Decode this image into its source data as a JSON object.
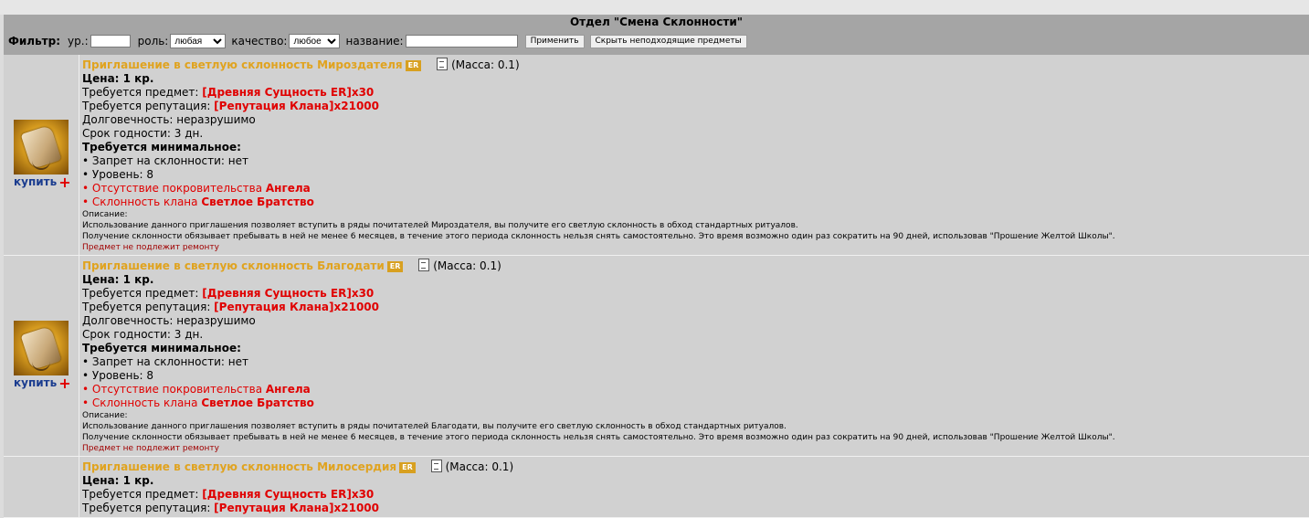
{
  "header": {
    "title": "Отдел \"Смена Склонности\""
  },
  "filter": {
    "label": "Фильтр:",
    "level_label": "ур.:",
    "level_value": "",
    "role_label": "роль:",
    "role_selected": "любая",
    "quality_label": "качество:",
    "quality_selected": "любое",
    "name_label": "название:",
    "name_value": "",
    "apply_button": "Применить",
    "hide_button": "Скрыть неподходящие предметы"
  },
  "items": [
    {
      "title": "Приглашение в светлую склонность Мироздателя",
      "badge": "ER",
      "mass": "(Масса: 0.1)",
      "price": "Цена: 1 кр.",
      "req_item_label": "Требуется предмет: ",
      "req_item_value": "[Древняя Сущность ER]x30",
      "req_rep_label": "Требуется репутация: ",
      "req_rep_value": "[Репутация Клана]x21000",
      "durability": "Долговечность: неразрушимо",
      "expiry": "Срок годности: 3 дн.",
      "min_req_header": "Требуется минимальное:",
      "req_ban": "• Запрет на склонности: нет",
      "req_level": "• Уровень: 8",
      "req_patron_prefix": "• Отсутствие покровительства ",
      "req_patron_value": "Ангела",
      "req_clan_prefix": "• Склонность клана ",
      "req_clan_value": "Светлое Братство",
      "desc_label": "Описание:",
      "desc_line1": "Использование данного приглашения позволяет вступить в ряды почитателей Мироздателя, вы получите его светлую склонность в обход стандартных ритуалов.",
      "desc_line2": "Получение склонности обязывает пребывать в ней не менее 6 месяцев, в течение этого периода склонность нельзя снять самостоятельно. Это время возможно один раз сократить на 90 дней, использовав \"Прошение Желтой Школы\".",
      "no_repair": "Предмет не подлежит ремонту",
      "buy_label": "купить",
      "buy_plus": "+"
    },
    {
      "title": "Приглашение в светлую склонность Благодати",
      "badge": "ER",
      "mass": "(Масса: 0.1)",
      "price": "Цена: 1 кр.",
      "req_item_label": "Требуется предмет: ",
      "req_item_value": "[Древняя Сущность ER]x30",
      "req_rep_label": "Требуется репутация: ",
      "req_rep_value": "[Репутация Клана]x21000",
      "durability": "Долговечность: неразрушимо",
      "expiry": "Срок годности: 3 дн.",
      "min_req_header": "Требуется минимальное:",
      "req_ban": "• Запрет на склонности: нет",
      "req_level": "• Уровень: 8",
      "req_patron_prefix": "• Отсутствие покровительства ",
      "req_patron_value": "Ангела",
      "req_clan_prefix": "• Склонность клана ",
      "req_clan_value": "Светлое Братство",
      "desc_label": "Описание:",
      "desc_line1": "Использование данного приглашения позволяет вступить в ряды почитателей Благодати, вы получите его светлую склонность в обход стандартных ритуалов.",
      "desc_line2": "Получение склонности обязывает пребывать в ней не менее 6 месяцев, в течение этого периода склонность нельзя снять самостоятельно. Это время возможно один раз сократить на 90 дней, использовав \"Прошение Желтой Школы\".",
      "no_repair": "Предмет не подлежит ремонту",
      "buy_label": "купить",
      "buy_plus": "+"
    },
    {
      "title": "Приглашение в светлую склонность Милосердия",
      "badge": "ER",
      "mass": "(Масса: 0.1)",
      "price": "Цена: 1 кр.",
      "req_item_label": "Требуется предмет: ",
      "req_item_value": "[Древняя Сущность ER]x30",
      "req_rep_label": "Требуется репутация: ",
      "req_rep_value": "[Репутация Клана]x21000"
    }
  ]
}
